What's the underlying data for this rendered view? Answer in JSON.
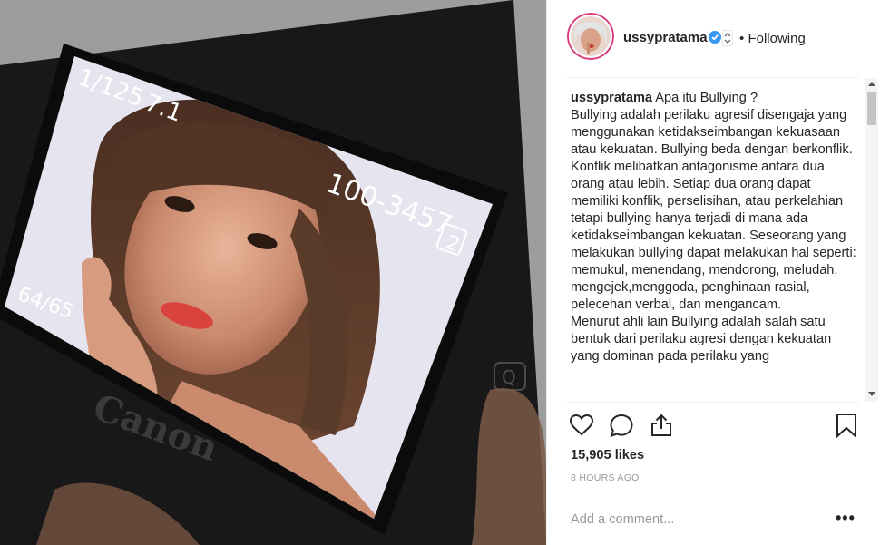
{
  "post_image": {
    "screen_readouts": {
      "shutter": "1/125",
      "aperture": "7.1",
      "file_number": "100-3457",
      "card_slot": "2",
      "frame_count": "64/65"
    },
    "camera_brand": "Canon"
  },
  "header": {
    "username": "ussypratama",
    "separator": "•",
    "follow_label": "Following"
  },
  "caption": {
    "username": "ussypratama",
    "text": "Apa itu Bullying ?\nBullying adalah perilaku agresif disengaja yang menggunakan ketidakseimbangan kekuasaan atau kekuatan. Bullying beda dengan berkonflik. Konflik melibatkan antagonisme antara dua orang atau lebih. Setiap dua orang dapat memiliki konflik, perselisihan, atau perkelahian tetapi bullying hanya terjadi di mana ada ketidakseimbangan kekuatan. Seseorang yang melakukan bullying dapat melakukan hal seperti: memukul, menendang, mendorong, meludah, mengejek,menggoda, penghinaan rasial, pelecehan verbal, dan mengancam.\nMenurut ahli lain Bullying adalah salah satu bentuk dari perilaku agresi dengan kekuatan yang dominan pada perilaku yang"
  },
  "actions": {
    "like_icon": "heart-icon",
    "comment_icon": "comment-icon",
    "share_icon": "share-icon",
    "save_icon": "bookmark-icon"
  },
  "likes": "15,905 likes",
  "timestamp": "8 HOURS AGO",
  "comment_box": {
    "placeholder": "Add a comment...",
    "more_label": "•••"
  },
  "colors": {
    "verified_blue": "#3897f0",
    "text": "#262626",
    "muted": "#999999",
    "avatar_ring": "#d93b7d"
  }
}
